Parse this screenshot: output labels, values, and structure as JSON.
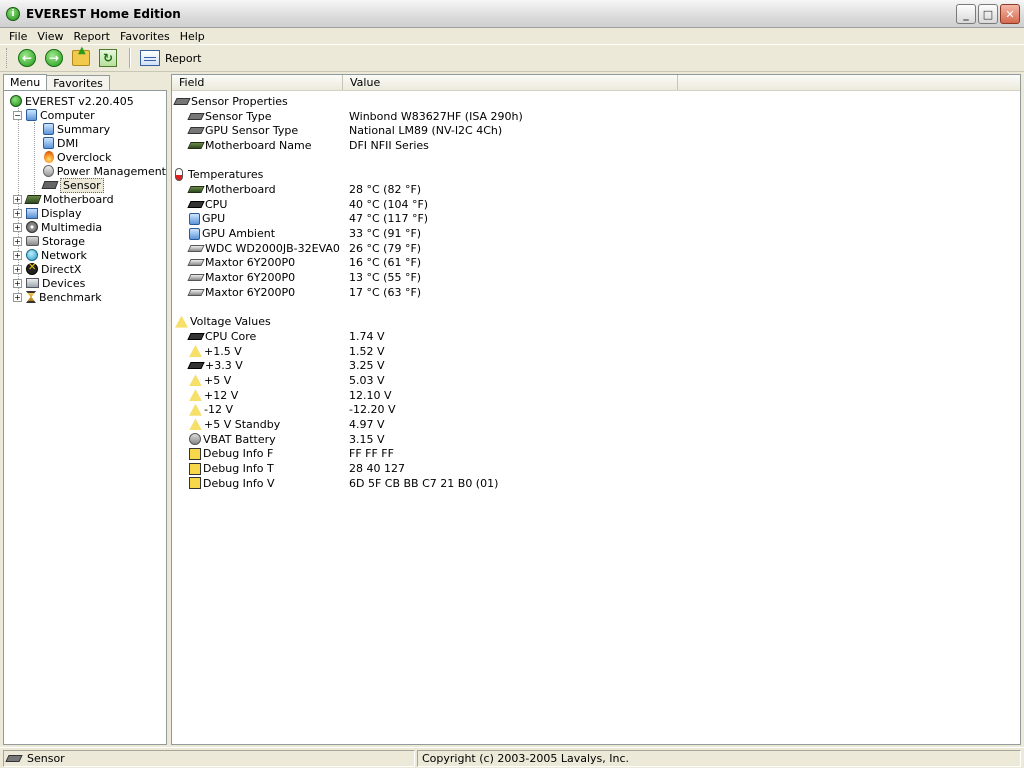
{
  "window": {
    "title": "EVEREST Home Edition"
  },
  "menu": [
    "File",
    "View",
    "Report",
    "Favorites",
    "Help"
  ],
  "toolbar": {
    "report_label": "Report"
  },
  "left_panel": {
    "tabs": [
      "Menu",
      "Favorites"
    ],
    "tree": {
      "root": "EVEREST v2.20.405",
      "computer": "Computer",
      "computer_children": [
        "Summary",
        "DMI",
        "Overclock",
        "Power Management",
        "Sensor"
      ],
      "top_nodes": [
        "Motherboard",
        "Display",
        "Multimedia",
        "Storage",
        "Network",
        "DirectX",
        "Devices",
        "Benchmark"
      ]
    }
  },
  "columns": {
    "field": "Field",
    "value": "Value"
  },
  "sections": {
    "sensor_properties": {
      "title": "Sensor Properties",
      "rows": [
        {
          "field": "Sensor Type",
          "value": "Winbond W83627HF  (ISA 290h)",
          "icon": "sensor-chip"
        },
        {
          "field": "GPU Sensor Type",
          "value": "National LM89  (NV-I2C 4Ch)",
          "icon": "sensor-chip"
        },
        {
          "field": "Motherboard Name",
          "value": "DFI NFII Series",
          "icon": "motherboard"
        }
      ]
    },
    "temperatures": {
      "title": "Temperatures",
      "rows": [
        {
          "field": "Motherboard",
          "value": "28 °C  (82 °F)",
          "icon": "motherboard"
        },
        {
          "field": "CPU",
          "value": "40 °C  (104 °F)",
          "icon": "cpu"
        },
        {
          "field": "GPU",
          "value": "47 °C  (117 °F)",
          "icon": "display"
        },
        {
          "field": "GPU Ambient",
          "value": "33 °C  (91 °F)",
          "icon": "display"
        },
        {
          "field": "WDC WD2000JB-32EVA0",
          "value": "26 °C  (79 °F)",
          "icon": "hdd"
        },
        {
          "field": "Maxtor 6Y200P0",
          "value": "16 °C  (61 °F)",
          "icon": "hdd"
        },
        {
          "field": "Maxtor 6Y200P0",
          "value": "13 °C  (55 °F)",
          "icon": "hdd"
        },
        {
          "field": "Maxtor 6Y200P0",
          "value": "17 °C  (63 °F)",
          "icon": "hdd"
        }
      ]
    },
    "voltages": {
      "title": "Voltage Values",
      "rows": [
        {
          "field": "CPU Core",
          "value": "1.74 V",
          "icon": "cpu"
        },
        {
          "field": "+1.5 V",
          "value": "1.52 V",
          "icon": "warning"
        },
        {
          "field": "+3.3 V",
          "value": "3.25 V",
          "icon": "cpu"
        },
        {
          "field": "+5 V",
          "value": "5.03 V",
          "icon": "warning"
        },
        {
          "field": "+12 V",
          "value": "12.10 V",
          "icon": "warning"
        },
        {
          "field": "-12 V",
          "value": "-12.20 V",
          "icon": "warning"
        },
        {
          "field": "+5 V Standby",
          "value": "4.97 V",
          "icon": "warning"
        },
        {
          "field": "VBAT Battery",
          "value": "3.15 V",
          "icon": "battery"
        },
        {
          "field": "Debug Info F",
          "value": "FF FF FF",
          "icon": "debug"
        },
        {
          "field": "Debug Info T",
          "value": "28 40 127",
          "icon": "debug"
        },
        {
          "field": "Debug Info V",
          "value": "6D 5F CB BB C7 21 B0 (01)",
          "icon": "debug"
        }
      ]
    }
  },
  "status": {
    "left": "Sensor",
    "right": "Copyright (c) 2003-2005 Lavalys, Inc."
  }
}
